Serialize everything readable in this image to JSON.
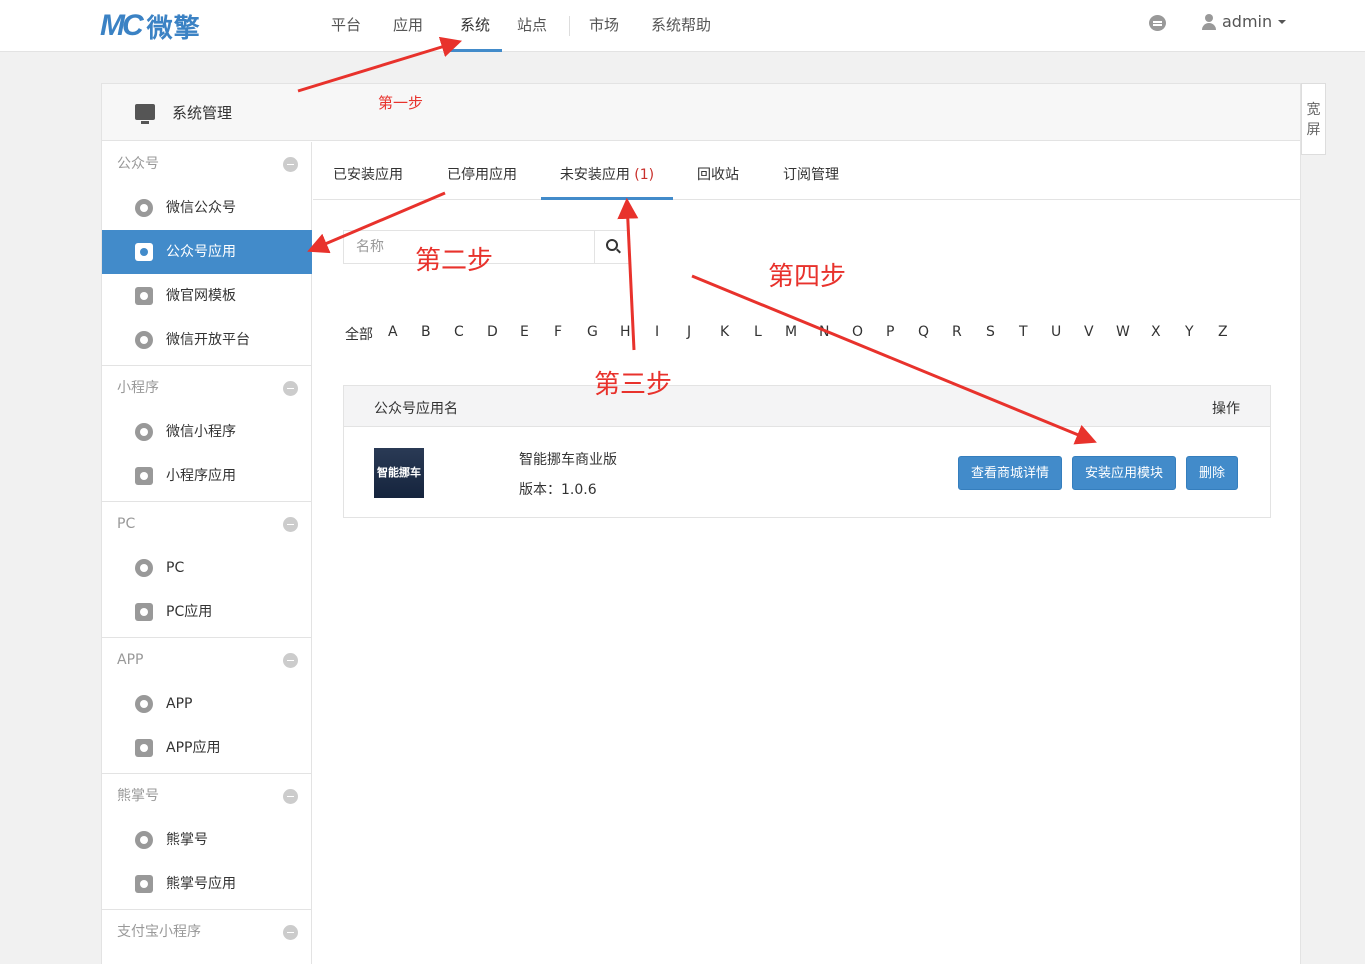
{
  "navbar": {
    "logo_mark": "MC",
    "logo_text": "微擎",
    "items": [
      {
        "label": "平台"
      },
      {
        "label": "应用"
      },
      {
        "label": "系统"
      },
      {
        "label": "站点"
      },
      {
        "label": "市场"
      },
      {
        "label": "系统帮助"
      }
    ],
    "active_item": "系统",
    "icons": [
      "message-icon",
      "user-icon",
      "caret-down-icon"
    ],
    "user": "admin"
  },
  "panel": {
    "title": "系统管理",
    "wide_toggle": "宽屏"
  },
  "sidebar": {
    "groups": [
      {
        "title": "公众号",
        "items": [
          {
            "label": "微信公众号"
          },
          {
            "label": "公众号应用"
          },
          {
            "label": "微官网模板"
          },
          {
            "label": "微信开放平台"
          }
        ]
      },
      {
        "title": "小程序",
        "items": [
          {
            "label": "微信小程序"
          },
          {
            "label": "小程序应用"
          }
        ]
      },
      {
        "title": "PC",
        "items": [
          {
            "label": "PC"
          },
          {
            "label": "PC应用"
          }
        ]
      },
      {
        "title": "APP",
        "items": [
          {
            "label": "APP"
          },
          {
            "label": "APP应用"
          }
        ]
      },
      {
        "title": "熊掌号",
        "items": [
          {
            "label": "熊掌号"
          },
          {
            "label": "熊掌号应用"
          }
        ]
      },
      {
        "title": "支付宝小程序",
        "items": []
      }
    ],
    "active_item": "公众号应用"
  },
  "tabs": [
    {
      "label": "已安装应用"
    },
    {
      "label": "已停用应用"
    },
    {
      "label": "未安装应用",
      "count": "(1)"
    },
    {
      "label": "回收站"
    },
    {
      "label": "订阅管理"
    }
  ],
  "active_tab": "未安装应用",
  "search": {
    "placeholder": "名称",
    "value": ""
  },
  "letters": [
    "全部",
    "A",
    "B",
    "C",
    "D",
    "E",
    "F",
    "G",
    "H",
    "I",
    "J",
    "K",
    "L",
    "M",
    "N",
    "O",
    "P",
    "Q",
    "R",
    "S",
    "T",
    "U",
    "V",
    "W",
    "X",
    "Y",
    "Z"
  ],
  "table": {
    "headers": {
      "name": "公众号应用名",
      "op": "操作"
    },
    "rows": [
      {
        "thumb_text": "智能挪车",
        "name": "智能挪车商业版",
        "version": "版本：1.0.6",
        "buttons": [
          {
            "label": "查看商城详情"
          },
          {
            "label": "安装应用模块"
          },
          {
            "label": "删除"
          }
        ]
      }
    ]
  },
  "annotations": {
    "step1": "第一步",
    "step2": "第二步",
    "step3": "第三步",
    "step4": "第四步",
    "color": "#e8322c"
  },
  "colors": {
    "accent": "#428bca",
    "count_red": "#c9302c"
  }
}
